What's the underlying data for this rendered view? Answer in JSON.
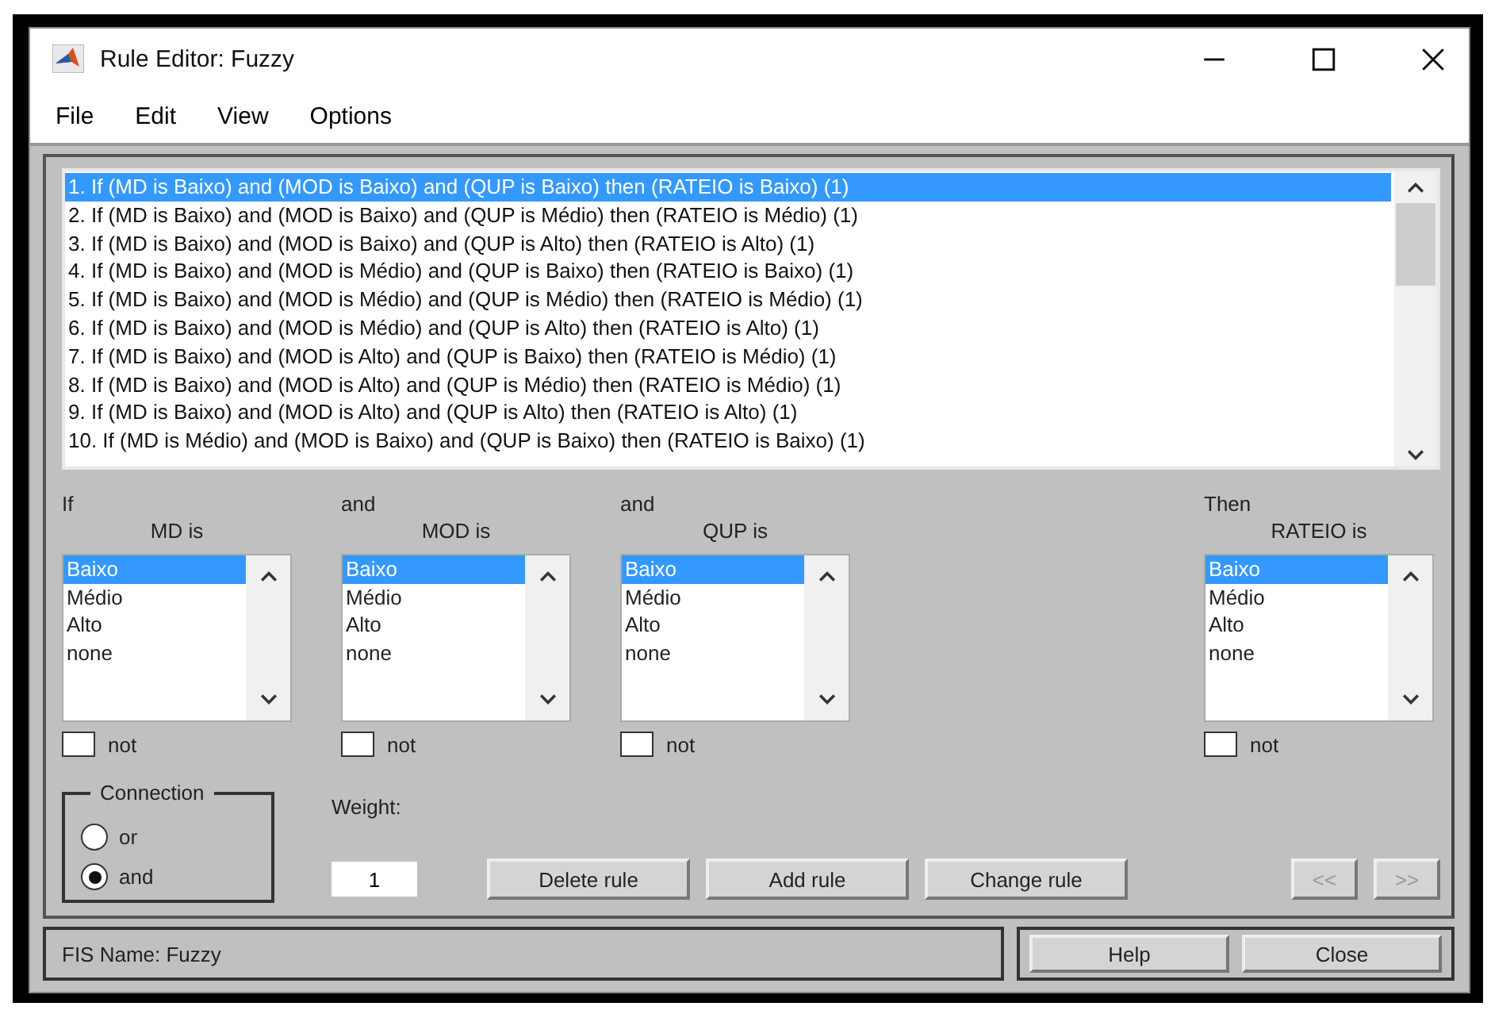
{
  "window": {
    "title": "Rule Editor: Fuzzy"
  },
  "menu": [
    "File",
    "Edit",
    "View",
    "Options"
  ],
  "rules": [
    {
      "text": "1. If (MD is Baixo) and (MOD is Baixo) and (QUP is Baixo) then (RATEIO is Baixo) (1)",
      "selected": true
    },
    {
      "text": "2. If (MD is Baixo) and (MOD is Baixo) and (QUP is Médio) then (RATEIO is Médio) (1)",
      "selected": false
    },
    {
      "text": "3. If (MD is Baixo) and (MOD is Baixo) and (QUP is Alto) then (RATEIO is Alto) (1)",
      "selected": false
    },
    {
      "text": "4. If (MD is Baixo) and (MOD is Médio) and (QUP is Baixo) then (RATEIO is Baixo) (1)",
      "selected": false
    },
    {
      "text": "5. If (MD is Baixo) and (MOD is Médio) and (QUP is Médio) then (RATEIO is Médio) (1)",
      "selected": false
    },
    {
      "text": "6. If (MD is Baixo) and (MOD is Médio) and (QUP is Alto) then (RATEIO is Alto) (1)",
      "selected": false
    },
    {
      "text": "7. If (MD is Baixo) and (MOD is Alto) and (QUP is Baixo) then (RATEIO is Médio) (1)",
      "selected": false
    },
    {
      "text": "8. If (MD is Baixo) and (MOD is Alto) and (QUP is Médio) then (RATEIO is Médio) (1)",
      "selected": false
    },
    {
      "text": "9. If (MD is Baixo) and (MOD is Alto) and (QUP is Alto) then (RATEIO is Alto) (1)",
      "selected": false
    },
    {
      "text": "10. If (MD is Médio) and (MOD is Baixo) and (QUP is Baixo) then (RATEIO is Baixo) (1)",
      "selected": false
    }
  ],
  "conditions": [
    {
      "connector": "If",
      "label": "MD is",
      "options": [
        {
          "label": "Baixo",
          "selected": true
        },
        {
          "label": "Médio",
          "selected": false
        },
        {
          "label": "Alto",
          "selected": false
        },
        {
          "label": "none",
          "selected": false
        }
      ],
      "not_label": "not",
      "not": false
    },
    {
      "connector": "and",
      "label": "MOD is",
      "options": [
        {
          "label": "Baixo",
          "selected": true
        },
        {
          "label": "Médio",
          "selected": false
        },
        {
          "label": "Alto",
          "selected": false
        },
        {
          "label": "none",
          "selected": false
        }
      ],
      "not_label": "not",
      "not": false
    },
    {
      "connector": "and",
      "label": "QUP is",
      "options": [
        {
          "label": "Baixo",
          "selected": true
        },
        {
          "label": "Médio",
          "selected": false
        },
        {
          "label": "Alto",
          "selected": false
        },
        {
          "label": "none",
          "selected": false
        }
      ],
      "not_label": "not",
      "not": false
    }
  ],
  "conclusion": {
    "connector": "Then",
    "label": "RATEIO is",
    "options": [
      {
        "label": "Baixo",
        "selected": true
      },
      {
        "label": "Médio",
        "selected": false
      },
      {
        "label": "Alto",
        "selected": false
      },
      {
        "label": "none",
        "selected": false
      }
    ],
    "not_label": "not",
    "not": false
  },
  "connection": {
    "title": "Connection",
    "options": [
      {
        "label": "or",
        "selected": false
      },
      {
        "label": "and",
        "selected": true
      }
    ]
  },
  "weight": {
    "label": "Weight:",
    "value": "1"
  },
  "buttons": [
    "Delete rule",
    "Add rule",
    "Change rule"
  ],
  "nav_buttons": [
    {
      "label": "<<",
      "disabled": true
    },
    {
      "label": ">>",
      "disabled": true
    }
  ],
  "status": "FIS Name: Fuzzy",
  "footer_buttons": [
    "Help",
    "Close"
  ]
}
